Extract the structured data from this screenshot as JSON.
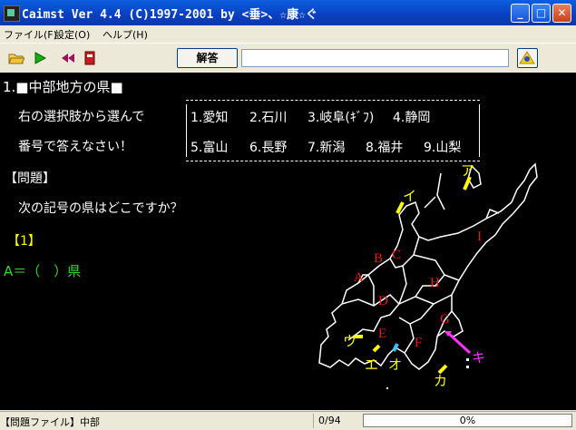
{
  "window": {
    "title": "Caimst Ver 4.4 (C)1997-2001  by <垂>、☆康☆ぐ"
  },
  "menu": {
    "items": [
      "ファイル(F)",
      "設定(O)",
      "ヘルプ(H)"
    ]
  },
  "toolbar": {
    "answer_label": "解答"
  },
  "question": {
    "heading": "1.■中部地方の県■",
    "instruction_line1": "右の選択肢から選んで",
    "instruction_line2": "番号で答えなさい！",
    "problem_label": "【問題】",
    "problem_text": "次の記号の県はどこですか？",
    "number": "【1】",
    "answer_prompt": "A＝（　）県"
  },
  "choices": {
    "row1": [
      "1.愛知",
      "2.石川",
      "3.岐阜(ｷﾞﾌ)",
      "4.静岡"
    ],
    "row2": [
      "5.富山",
      "6.長野",
      "7.新潟",
      "8.福井",
      "9.山梨"
    ]
  },
  "map": {
    "red_labels": [
      "A",
      "B",
      "C",
      "D",
      "E",
      "F",
      "G",
      "H",
      "I"
    ],
    "yellow_labels": [
      "ア",
      "イ",
      "ウ",
      "エ",
      "オ",
      "カ"
    ],
    "magenta_labels": [
      "キ"
    ]
  },
  "status": {
    "file": "【問題ファイル】中部",
    "count": "0/94",
    "progress": "0%",
    "progress_value": 0
  },
  "colors": {
    "title_bar": "#0a3fc0",
    "content_bg": "#000000",
    "prompt_green": "#3cd33c",
    "map_red": "#e02020",
    "map_yellow": "#ffff00",
    "map_magenta": "#ff33ff"
  }
}
